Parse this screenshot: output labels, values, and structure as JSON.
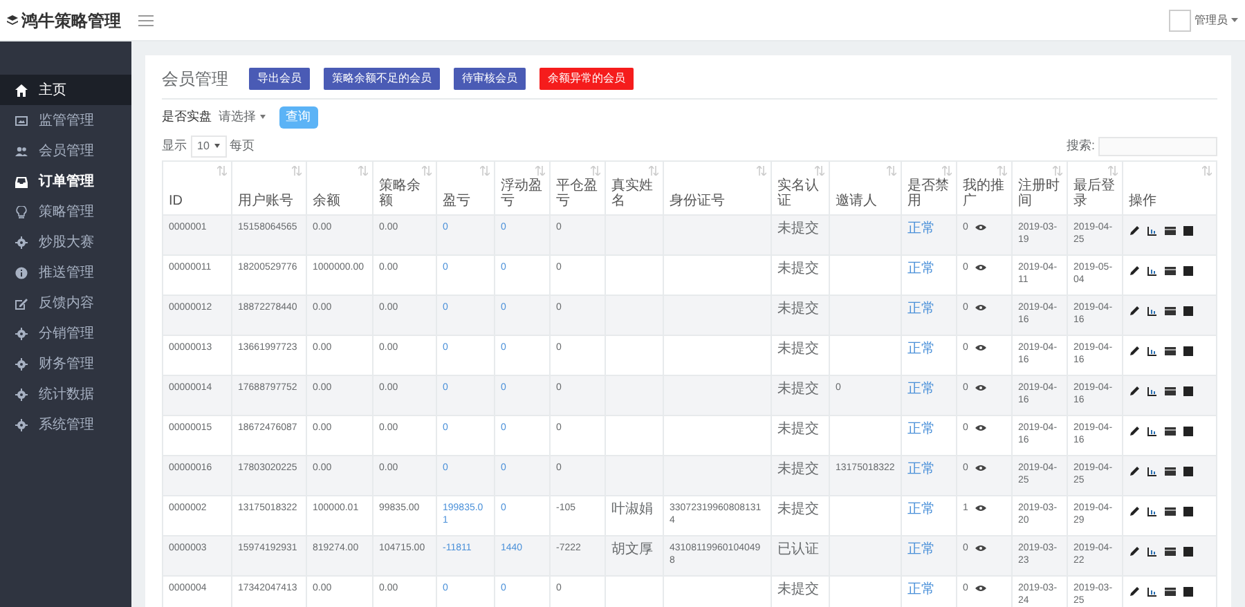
{
  "app": {
    "title": "鸿牛策略管理",
    "user": "管理员"
  },
  "sidebar": {
    "items": [
      {
        "label": "主页",
        "selected": true,
        "emphasized": false
      },
      {
        "label": "监管管理",
        "selected": false,
        "emphasized": false
      },
      {
        "label": "会员管理",
        "selected": false,
        "emphasized": false
      },
      {
        "label": "订单管理",
        "selected": false,
        "emphasized": true
      },
      {
        "label": "策略管理",
        "selected": false,
        "emphasized": false
      },
      {
        "label": "炒股大赛",
        "selected": false,
        "emphasized": false
      },
      {
        "label": "推送管理",
        "selected": false,
        "emphasized": false
      },
      {
        "label": "反馈内容",
        "selected": false,
        "emphasized": false
      },
      {
        "label": "分销管理",
        "selected": false,
        "emphasized": false
      },
      {
        "label": "财务管理",
        "selected": false,
        "emphasized": false
      },
      {
        "label": "统计数据",
        "selected": false,
        "emphasized": false
      },
      {
        "label": "系统管理",
        "selected": false,
        "emphasized": false
      }
    ]
  },
  "panel": {
    "title": "会员管理",
    "buttons": [
      {
        "label": "导出会员",
        "kind": "primary"
      },
      {
        "label": "策略余额不足的会员",
        "kind": "primary"
      },
      {
        "label": "待审核会员",
        "kind": "primary"
      },
      {
        "label": "余额异常的会员",
        "kind": "danger"
      }
    ],
    "filter": {
      "label": "是否实盘",
      "value": "请选择",
      "button": "查询"
    },
    "page_size": {
      "before": "显示",
      "value": "10",
      "after": "每页"
    },
    "search": {
      "label": "搜索:"
    }
  },
  "table": {
    "columns": [
      {
        "label": "ID",
        "kind": "text"
      },
      {
        "label": "用户账号",
        "kind": "text"
      },
      {
        "label": "余额",
        "kind": "text"
      },
      {
        "label": "策略余额",
        "kind": "text"
      },
      {
        "label": "盈亏",
        "kind": "link"
      },
      {
        "label": "浮动盈亏",
        "kind": "link"
      },
      {
        "label": "平仓盈亏",
        "kind": "text"
      },
      {
        "label": "真实姓名",
        "kind": "text"
      },
      {
        "label": "身份证号",
        "kind": "text"
      },
      {
        "label": "实名认证",
        "kind": "text"
      },
      {
        "label": "邀请人",
        "kind": "text"
      },
      {
        "label": "是否禁用",
        "kind": "link"
      },
      {
        "label": "我的推广",
        "kind": "promo"
      },
      {
        "label": "注册时间",
        "kind": "text"
      },
      {
        "label": "最后登录",
        "kind": "text"
      },
      {
        "label": "操作",
        "kind": "actions"
      }
    ],
    "rows": [
      {
        "cells": [
          "0000001",
          "15158064565",
          "0.00",
          "0.00",
          "0",
          "0",
          "0",
          null,
          null,
          "未提交",
          null,
          "正常",
          "0",
          "2019-03-19",
          "2019-04-25"
        ]
      },
      {
        "cells": [
          "00000011",
          "18200529776",
          "1000000.00",
          "0.00",
          "0",
          "0",
          "0",
          null,
          null,
          "未提交",
          null,
          "正常",
          "0",
          "2019-04-11",
          "2019-05-04"
        ]
      },
      {
        "cells": [
          "00000012",
          "18872278440",
          "0.00",
          "0.00",
          "0",
          "0",
          "0",
          null,
          null,
          "未提交",
          null,
          "正常",
          "0",
          "2019-04-16",
          "2019-04-16"
        ]
      },
      {
        "cells": [
          "00000013",
          "13661997723",
          "0.00",
          "0.00",
          "0",
          "0",
          "0",
          null,
          null,
          "未提交",
          null,
          "正常",
          "0",
          "2019-04-16",
          "2019-04-16"
        ]
      },
      {
        "cells": [
          "00000014",
          "17688797752",
          "0.00",
          "0.00",
          "0",
          "0",
          "0",
          null,
          null,
          "未提交",
          "0",
          "正常",
          "0",
          "2019-04-16",
          "2019-04-16"
        ]
      },
      {
        "cells": [
          "00000015",
          "18672476087",
          "0.00",
          "0.00",
          "0",
          "0",
          "0",
          null,
          null,
          "未提交",
          null,
          "正常",
          "0",
          "2019-04-16",
          "2019-04-16"
        ]
      },
      {
        "cells": [
          "00000016",
          "17803020225",
          "0.00",
          "0.00",
          "0",
          "0",
          "0",
          null,
          null,
          "未提交",
          "13175018322",
          "正常",
          "0",
          "2019-04-25",
          "2019-04-25"
        ]
      },
      {
        "cells": [
          "0000002",
          "13175018322",
          "100000.01",
          "99835.00",
          "199835.01",
          "0",
          "-105",
          "叶淑娟",
          "330723199608081314",
          "未提交",
          null,
          "正常",
          "1",
          "2019-03-20",
          "2019-04-29"
        ]
      },
      {
        "cells": [
          "0000003",
          "15974192931",
          "819274.00",
          "104715.00",
          "-11811",
          "1440",
          "-7222",
          "胡文厚",
          "431081199601040498",
          "已认证",
          null,
          "正常",
          "0",
          "2019-03-23",
          "2019-04-22"
        ]
      },
      {
        "cells": [
          "0000004",
          "17342047413",
          "0.00",
          "0.00",
          "0",
          "0",
          "0",
          null,
          null,
          "未提交",
          null,
          "正常",
          "0",
          "2019-03-24",
          "2019-03-25"
        ]
      }
    ]
  }
}
